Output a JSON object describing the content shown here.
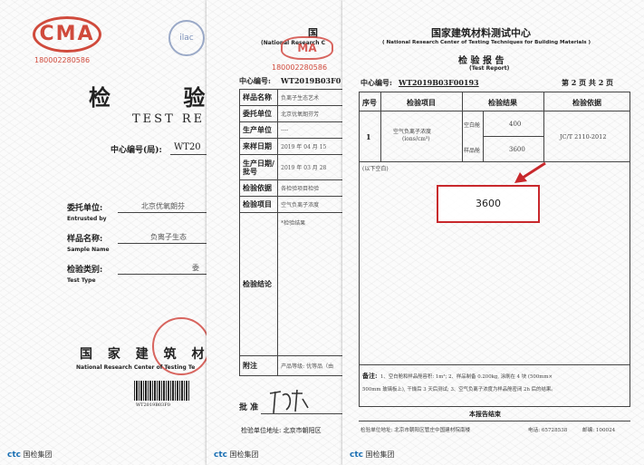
{
  "page1": {
    "cma_logo": "CMA",
    "cma_number": "180002280586",
    "ilac_logo": "ilac",
    "title_cn": "检 验",
    "title_en": "TEST RE",
    "center_no_label": "中心编号(局):",
    "center_no_value": "WT20",
    "client_label": "委托单位:",
    "client_label_en": "Entrusted by",
    "client_value": "北京优氧朗芬",
    "sample_label": "样品名称:",
    "sample_label_en": "Sample Name",
    "sample_value": "负离子生态",
    "type_label": "检验类别:",
    "type_label_en": "Test Type",
    "type_value": "委",
    "footer_cn": "国 家 建 筑 材 料",
    "footer_en": "National Research Center of Testing Te",
    "barcode_text": "WT2019B03F0",
    "ctc_brand": "ctc",
    "ctc_name": "国检集团"
  },
  "page2": {
    "cma_logo": "MA",
    "cma_number": "180002280586",
    "header_cn": "国",
    "header_en": "(National Research C",
    "center_no_label": "中心编号:",
    "center_no_value": "WT2019B03F0",
    "rows": [
      {
        "label": "样品名称",
        "value": "负离子生态艺术"
      },
      {
        "label": "委托单位",
        "value": "北京优氧朗芬芳"
      },
      {
        "label": "生产单位",
        "value": "----"
      },
      {
        "label": "来样日期",
        "value": "2019 年 04 月 15"
      },
      {
        "label": "生产日期/批号",
        "value": "2019 年 03 月 28"
      },
      {
        "label": "检验依据",
        "value": "各检验项目检验"
      },
      {
        "label": "检验项目",
        "value": "空气负离子浓度"
      }
    ],
    "result_note": "*检验结果",
    "conclusion_label": "检验结论",
    "remark_label": "附注",
    "remark_value": "产品等级: 优等品（由",
    "approve_label": "批  准",
    "address": "检验单位地址: 北京市朝阳区",
    "ctc_brand": "ctc",
    "ctc_name": "国检集团"
  },
  "page3": {
    "title_cn": "国家建筑材料测试中心",
    "title_en": "( National Research Center of Testing Techniques for Building Materials )",
    "report_cn": "检 验 报 告",
    "report_en": "(Test Report)",
    "center_no_label": "中心编号:",
    "center_no_value": "WT2019B03F00193",
    "page_info": "第 2 页  共 2 页",
    "headers": [
      "序号",
      "检验项目",
      "检验结果",
      "检验依据"
    ],
    "row": {
      "no": "1",
      "item_line1": "空气负离子浓度",
      "item_line2": "(ions/cm³)",
      "sub1_label": "空白舱",
      "sub1_value": "400",
      "sub2_label": "样品舱",
      "sub2_value": "3600",
      "basis": "JC/T 2110-2012"
    },
    "blank_note": "(以下空白)",
    "highlight_value": "3600",
    "remark_label": "备注:",
    "remark_text_1": "1、空白舱和样品舱容积: 1m³; 2、样品制备 0.200kg, 涂刷在 4 块 (500mm×",
    "remark_text_2": "500mm 玻璃板上), 干燥后 3 天后测试; 3、空气负离子浓度为样品舱密闭 2h 后的结果。",
    "end_text": "本报告结束",
    "footer_address": "检验单位地址: 北京市朝阳区管庄中国建材院南楼",
    "footer_phone": "电话: 65728538",
    "footer_post": "邮编: 100024",
    "ctc_brand": "ctc",
    "ctc_name": "国检集团"
  },
  "colors": {
    "stamp_red": "#d04a3c",
    "highlight_red": "#c8282c",
    "ctc_blue": "#1a6fb3"
  }
}
